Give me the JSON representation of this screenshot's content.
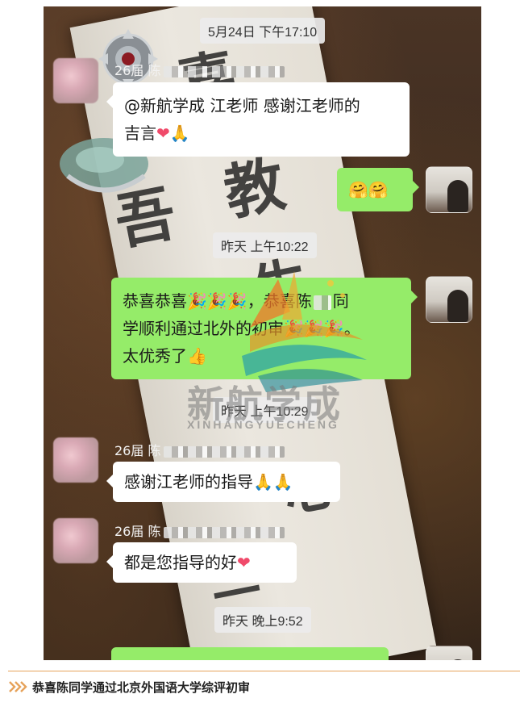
{
  "chat": {
    "timestamps": [
      "5月24日 下午17:10",
      "昨天 上午10:22",
      "昨天 上午10:29",
      "昨天 晚上9:52"
    ],
    "messages": [
      {
        "sender": "26届 陈",
        "text_1": "@新航学成 江老师  感谢江老师的",
        "text_2": "吉言",
        "emoji": "❤🙏"
      },
      {
        "emoji": "🤗🤗"
      },
      {
        "text_1": "恭喜恭喜",
        "emoji_1": "🎉🎉🎉",
        "text_2": "，恭喜陈",
        "text_3": "同",
        "text_4": "学顺利通过北外的初审",
        "emoji_2": "🎉🎉🎉",
        "text_5": "。",
        "text_6": "太优秀了",
        "emoji_3": "👍"
      },
      {
        "sender": "26届 陈",
        "text": "感谢江老师的指导",
        "emoji": "🙏🙏"
      },
      {
        "sender": "26届 陈",
        "text": "都是您指导的好",
        "emoji": "❤"
      }
    ]
  },
  "watermark": {
    "title": "新航学成",
    "subtitle": "XINHANGYUECHENG"
  },
  "caption": {
    "text": "恭喜陈同学通过北京外国语大学综评初审"
  },
  "colors": {
    "green_bubble": "#95ec69",
    "white_bubble": "#ffffff",
    "accent_line": "#e6a25a"
  },
  "icons": [
    "chevron-right-double-icon",
    "heart-emoji",
    "pray-emoji",
    "party-popper-emoji",
    "hug-emoji",
    "thumbs-up-emoji"
  ]
}
